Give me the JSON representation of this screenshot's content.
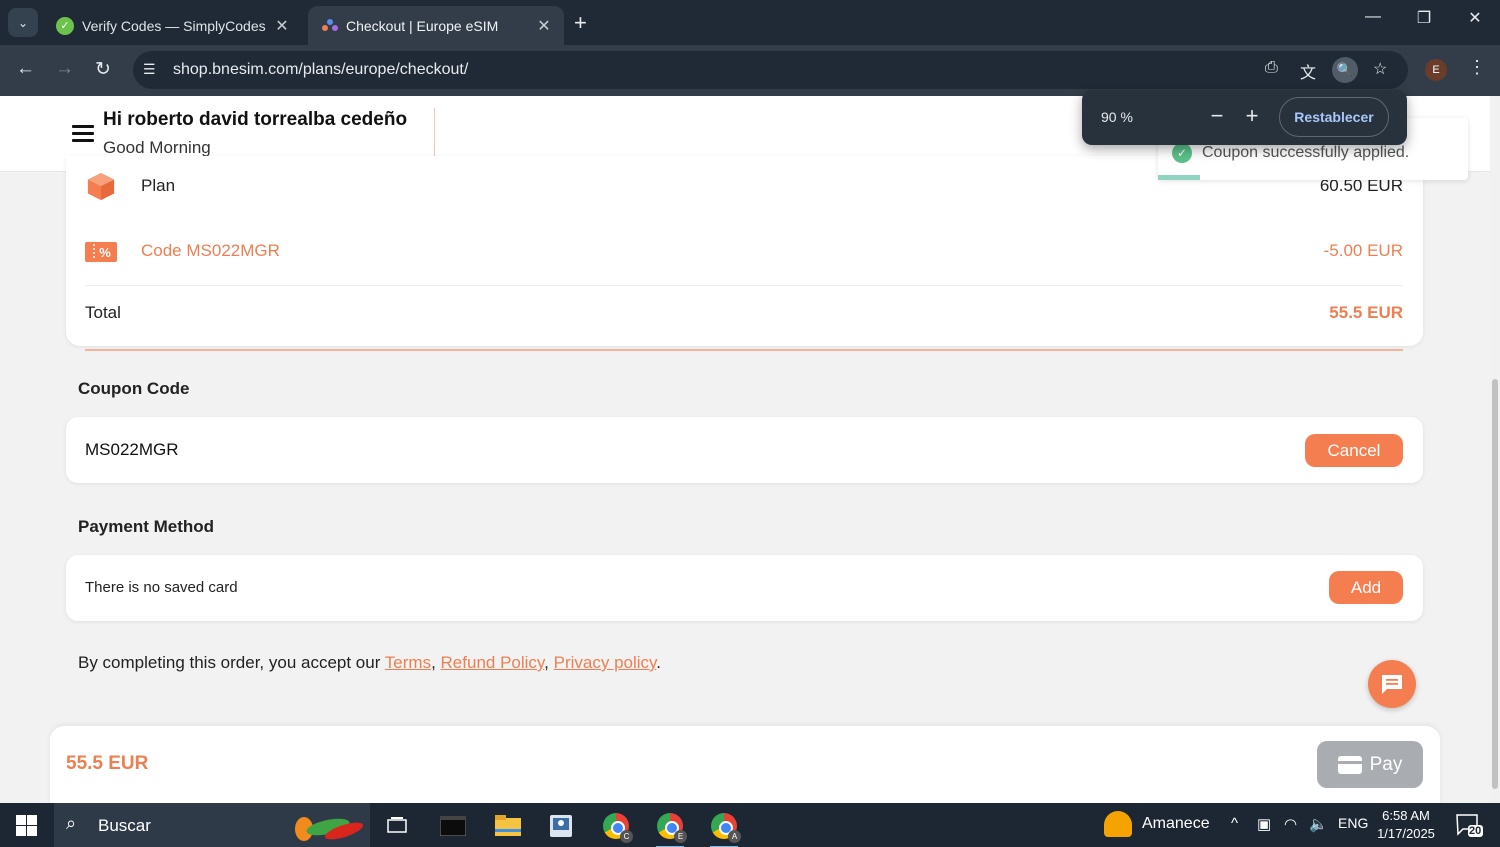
{
  "browser": {
    "tabs": [
      {
        "title": "Verify Codes — SimplyCodes",
        "icon": "simplycodes-icon",
        "active": false
      },
      {
        "title": "Checkout | Europe eSIM",
        "icon": "esim-icon",
        "active": true
      }
    ],
    "url": "shop.bnesim.com/plans/europe/checkout/",
    "profile_initial": "E"
  },
  "zoom_popup": {
    "level": "90 %",
    "reset_label": "Restablecer"
  },
  "toast": {
    "message": "Coupon successfully applied."
  },
  "header": {
    "greeting": "Hi roberto david torrealba cedeño",
    "subgreeting": "Good Morning"
  },
  "summary": {
    "plan_label": "Plan",
    "plan_price": "60.50 EUR",
    "code_label": "Code MS022MGR",
    "code_discount": "-5.00 EUR",
    "total_label": "Total",
    "total_value": "55.5 EUR"
  },
  "coupon": {
    "title": "Coupon Code",
    "value": "MS022MGR",
    "cancel_label": "Cancel"
  },
  "payment": {
    "title": "Payment Method",
    "empty_text": "There is no saved card",
    "add_label": "Add"
  },
  "terms": {
    "prefix": "By completing this order, you accept our ",
    "terms_link": "Terms",
    "sep1": ", ",
    "refund_link": "Refund Policy",
    "sep2": ", ",
    "privacy_link": "Privacy policy",
    "suffix": "."
  },
  "bottom_bar": {
    "total": "55.5 EUR",
    "pay_label": "Pay"
  },
  "taskbar": {
    "search_placeholder": "Buscar",
    "weather_text": "Amanece",
    "language": "ENG",
    "time": "6:58 AM",
    "date": "1/17/2025",
    "notification_count": "20",
    "chrome_profiles": [
      "C",
      "E",
      "A"
    ]
  },
  "colors": {
    "accent": "#f47e4f",
    "accent_text": "#ee7f52",
    "disabled_button": "#a9acb1",
    "chrome_dark": "#1f2a36"
  }
}
